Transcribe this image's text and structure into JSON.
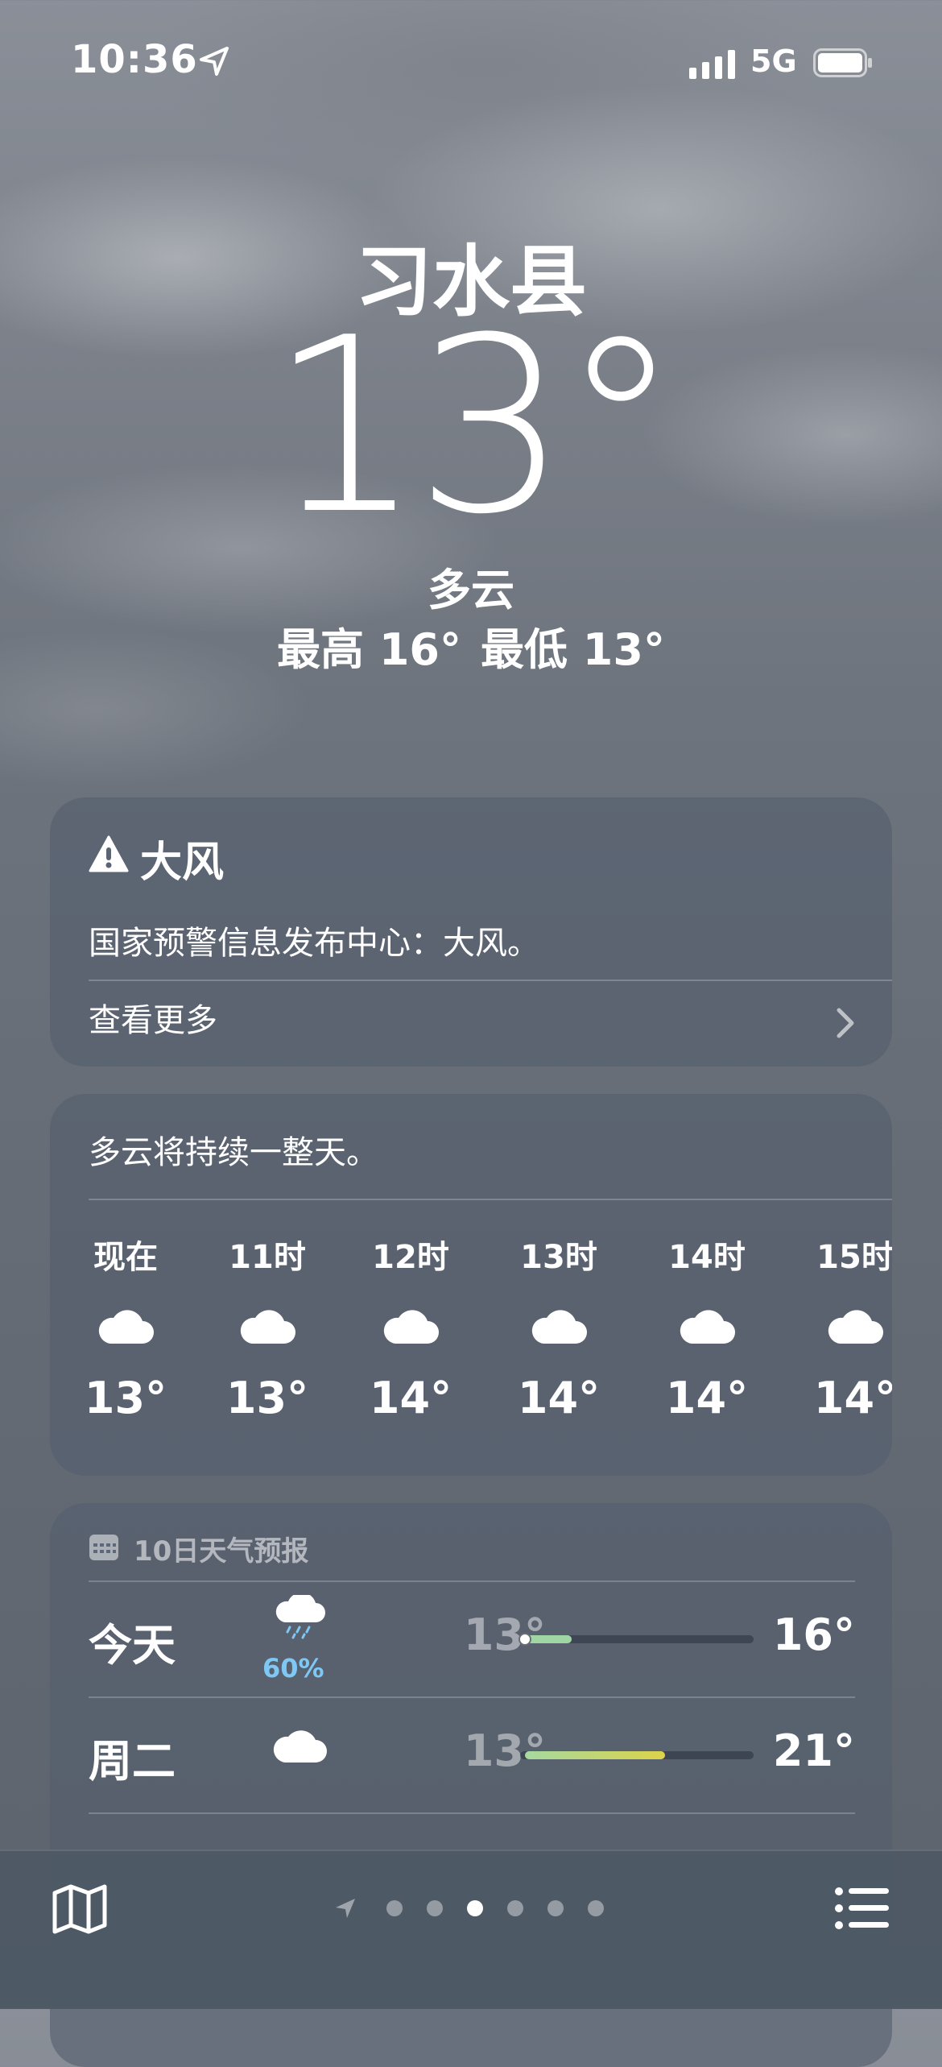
{
  "status_bar": {
    "time": "10:36",
    "network": "5G",
    "icons": [
      "location-arrow-icon",
      "signal-icon",
      "battery-icon"
    ]
  },
  "current": {
    "city": "习水县",
    "temperature": "13°",
    "condition": "多云",
    "high": "最高 16°",
    "low": "最低 13°"
  },
  "alert": {
    "icon": "warning-icon",
    "title": "大风",
    "text": "国家预警信息发布中心：大风。",
    "more_label": "查看更多"
  },
  "hourly": {
    "summary": "多云将持续一整天。",
    "hours": [
      {
        "label": "现在",
        "icon": "cloud-icon",
        "temp": "13°"
      },
      {
        "label": "11时",
        "icon": "cloud-icon",
        "temp": "13°"
      },
      {
        "label": "12时",
        "icon": "cloud-icon",
        "temp": "14°"
      },
      {
        "label": "13时",
        "icon": "cloud-icon",
        "temp": "14°"
      },
      {
        "label": "14时",
        "icon": "cloud-icon",
        "temp": "14°"
      },
      {
        "label": "15时",
        "icon": "cloud-icon",
        "temp": "14°"
      }
    ]
  },
  "forecast": {
    "header": "10日天气预报",
    "days": [
      {
        "day": "今天",
        "icon": "cloud-rain-icon",
        "precip": "60%",
        "low": "13°",
        "high": "16°",
        "range_start": 0.0,
        "range_end": 0.22,
        "current_marker": 0.02,
        "fill_colors": [
          "#9fd6a4",
          "#9fd6a4"
        ]
      },
      {
        "day": "周二",
        "icon": "cloud-icon",
        "precip": "",
        "low": "13°",
        "high": "21°",
        "range_start": 0.02,
        "range_end": 0.62,
        "current_marker": null,
        "fill_colors": [
          "#a6d9a0",
          "#dcd34a"
        ]
      }
    ]
  },
  "toolbar": {
    "left_icon": "map-icon",
    "right_icon": "list-icon",
    "page_count": 6,
    "active_page": 3
  },
  "colors": {
    "precip": "#7fc8f5",
    "card": "rgba(84,94,110,0.62)"
  }
}
